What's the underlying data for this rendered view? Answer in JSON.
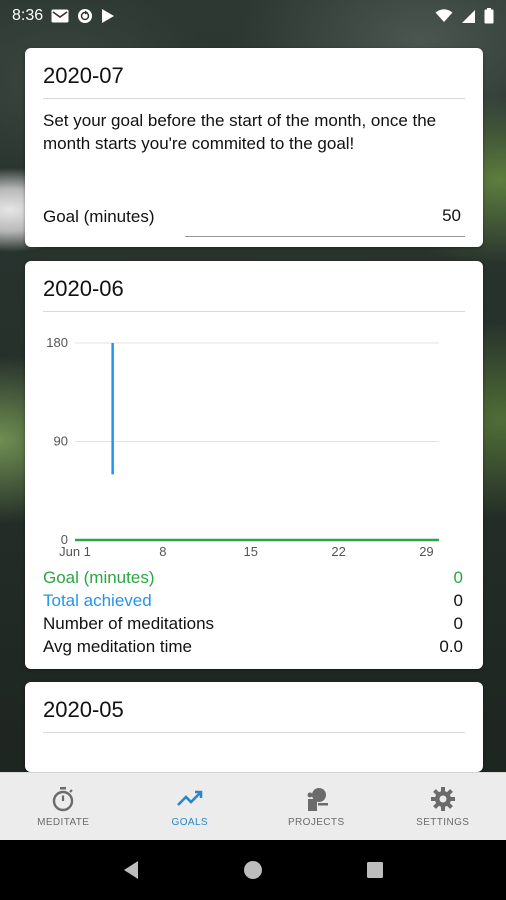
{
  "status_bar": {
    "time": "8:36",
    "icons_left": [
      "gmail-icon",
      "sync-icon",
      "play-store-icon"
    ],
    "icons_right": [
      "wifi-icon",
      "cell-signal-icon",
      "battery-icon"
    ]
  },
  "cards": {
    "july": {
      "title": "2020-07",
      "message": "Set your goal before the start of the month, once the month starts you're commited to the goal!",
      "goal_label": "Goal (minutes)",
      "goal_value": "50"
    },
    "june": {
      "title": "2020-06",
      "stats": {
        "goal_label": "Goal (minutes)",
        "goal_value": "0",
        "total_label": "Total achieved",
        "total_value": "0",
        "meditations_label": "Number of meditations",
        "meditations_value": "0",
        "avg_label": "Avg meditation time",
        "avg_value": "0.0"
      }
    },
    "may": {
      "title": "2020-05"
    }
  },
  "chart_data": {
    "type": "line",
    "x_tick_labels": [
      "Jun 1",
      "8",
      "15",
      "22",
      "29"
    ],
    "x_ticks": [
      1,
      8,
      15,
      22,
      29
    ],
    "y_tick_labels": [
      "0",
      "90",
      "180"
    ],
    "y_ticks": [
      0,
      90,
      180
    ],
    "xlim": [
      1,
      30
    ],
    "ylim": [
      0,
      180
    ],
    "series": [
      {
        "color": "#2196e8",
        "segments": [
          {
            "x": 4,
            "y_from": 60,
            "y_to": 180
          }
        ]
      },
      {
        "color": "#2aa642",
        "points": [
          {
            "x": 1,
            "y": 0
          },
          {
            "x": 30,
            "y": 0
          }
        ]
      }
    ],
    "grid": true
  },
  "bottom_nav": {
    "items": [
      {
        "label": "MEDITATE",
        "icon": "stopwatch-icon",
        "active": false
      },
      {
        "label": "GOALS",
        "icon": "trending-up-icon",
        "active": true
      },
      {
        "label": "PROJECTS",
        "icon": "projects-icon",
        "active": false
      },
      {
        "label": "SETTINGS",
        "icon": "gear-icon",
        "active": false
      }
    ]
  },
  "colors": {
    "goal_green": "#2aa642",
    "achieved_blue": "#2196e8",
    "nav_active": "#2b86c5"
  }
}
